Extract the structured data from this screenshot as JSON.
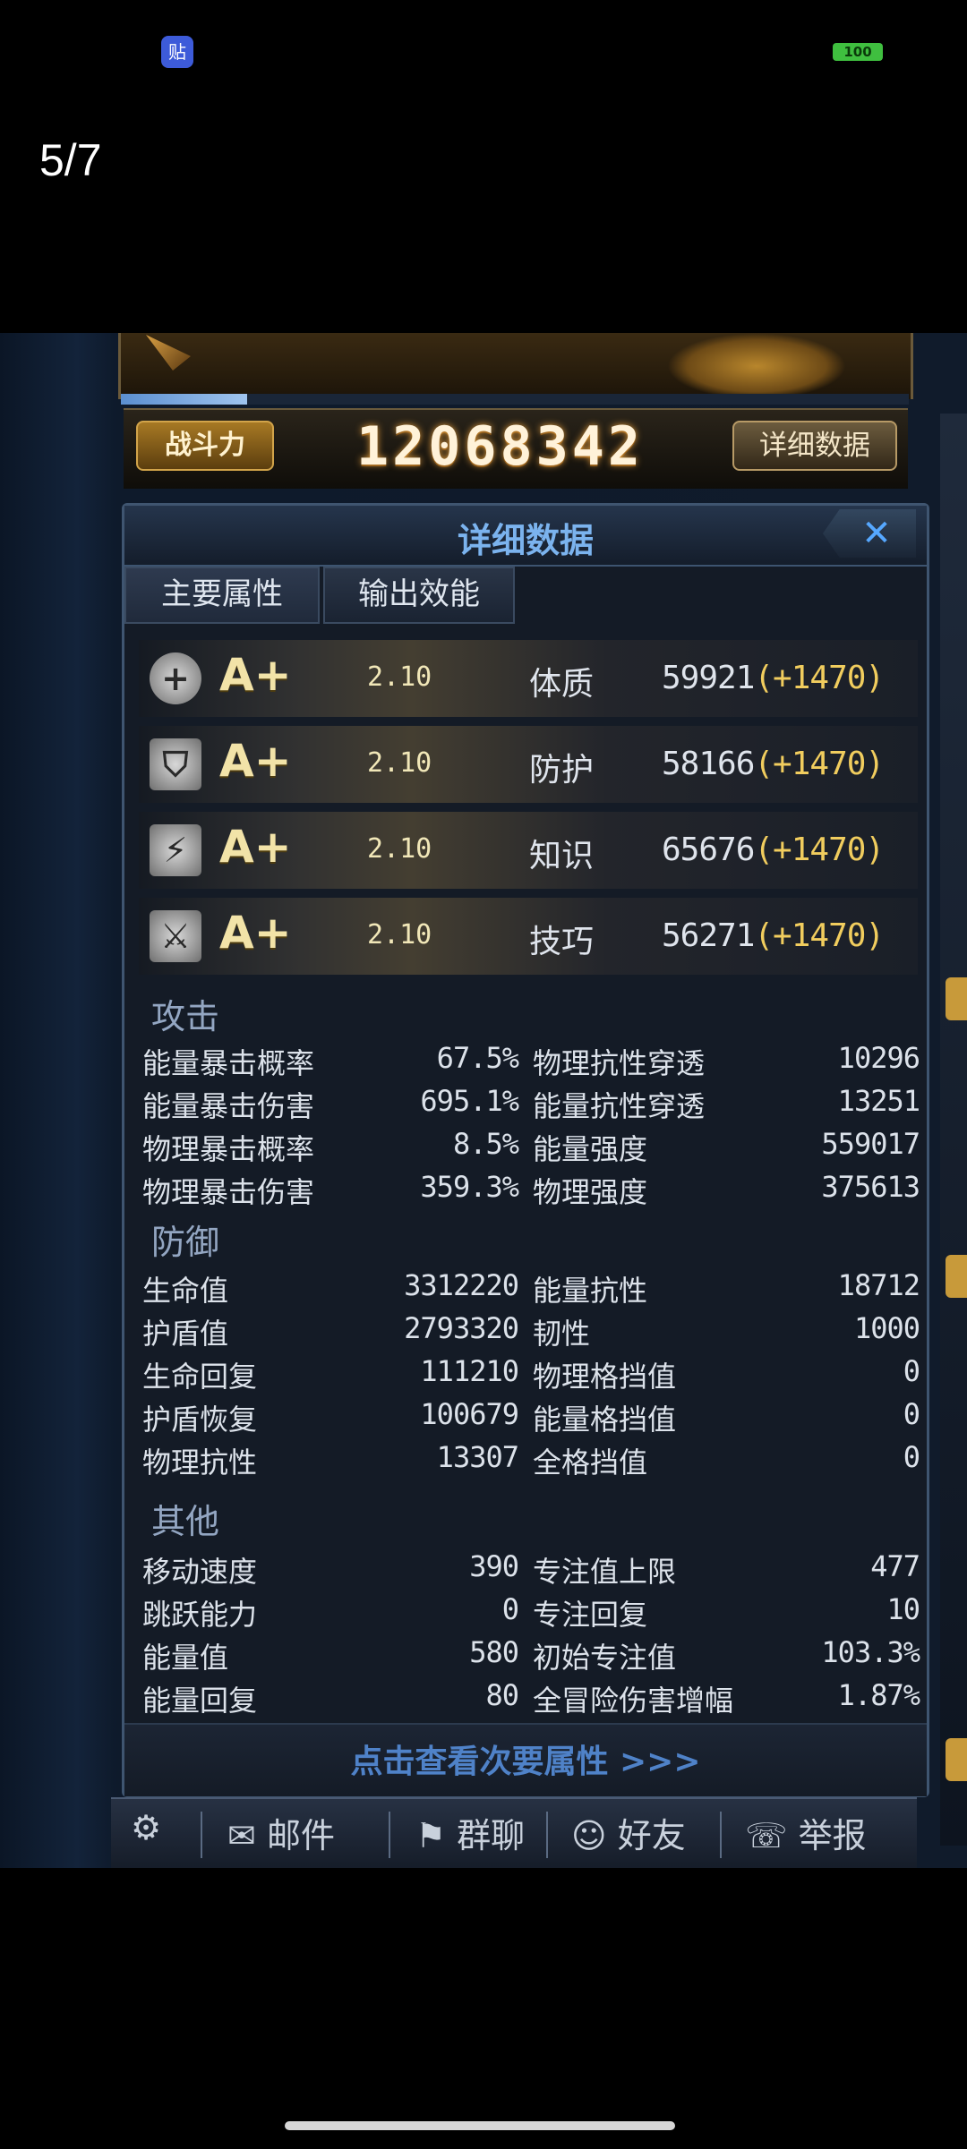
{
  "status_bar": {
    "app_icon_label": "贴",
    "battery_label": "100"
  },
  "viewer": {
    "counter": "5/7"
  },
  "game": {
    "combat_power_label": "战斗力",
    "combat_power_value": "12068342",
    "detail_button_label": "详细数据",
    "xp_fraction": 0.16,
    "panel_title": "详细数据",
    "close_label": "✕",
    "tabs": [
      {
        "label": "主要属性"
      },
      {
        "label": "输出效能"
      }
    ],
    "attributes": [
      {
        "icon": "plus-icon",
        "grade": "A+",
        "multiplier": "2.10",
        "name": "体质",
        "value": "59921",
        "bonus": "(+1470)"
      },
      {
        "icon": "shield-icon",
        "grade": "A+",
        "multiplier": "2.10",
        "name": "防护",
        "value": "58166",
        "bonus": "(+1470)"
      },
      {
        "icon": "knowledge-icon",
        "grade": "A+",
        "multiplier": "2.10",
        "name": "知识",
        "value": "65676",
        "bonus": "(+1470)"
      },
      {
        "icon": "sword-icon",
        "grade": "A+",
        "multiplier": "2.10",
        "name": "技巧",
        "value": "56271",
        "bonus": "(+1470)"
      }
    ],
    "sections": [
      {
        "title": "攻击",
        "rows": [
          {
            "l_label": "能量暴击概率",
            "l_val": "67.5%",
            "r_label": "物理抗性穿透",
            "r_val": "10296"
          },
          {
            "l_label": "能量暴击伤害",
            "l_val": "695.1%",
            "r_label": "能量抗性穿透",
            "r_val": "13251"
          },
          {
            "l_label": "物理暴击概率",
            "l_val": "8.5%",
            "r_label": "能量强度",
            "r_val": "559017"
          },
          {
            "l_label": "物理暴击伤害",
            "l_val": "359.3%",
            "r_label": "物理强度",
            "r_val": "375613"
          }
        ]
      },
      {
        "title": "防御",
        "rows": [
          {
            "l_label": "生命值",
            "l_val": "3312220",
            "r_label": "能量抗性",
            "r_val": "18712"
          },
          {
            "l_label": "护盾值",
            "l_val": "2793320",
            "r_label": "韧性",
            "r_val": "1000"
          },
          {
            "l_label": "生命回复",
            "l_val": "111210",
            "r_label": "物理格挡值",
            "r_val": "0"
          },
          {
            "l_label": "护盾恢复",
            "l_val": "100679",
            "r_label": "能量格挡值",
            "r_val": "0"
          },
          {
            "l_label": "物理抗性",
            "l_val": "13307",
            "r_label": "全格挡值",
            "r_val": "0"
          }
        ]
      },
      {
        "title": "其他",
        "rows": [
          {
            "l_label": "移动速度",
            "l_val": "390",
            "r_label": "专注值上限",
            "r_val": "477"
          },
          {
            "l_label": "跳跃能力",
            "l_val": "0",
            "r_label": "专注回复",
            "r_val": "10"
          },
          {
            "l_label": "能量值",
            "l_val": "580",
            "r_label": "初始专注值",
            "r_val": "103.3%"
          },
          {
            "l_label": "能量回复",
            "l_val": "80",
            "r_label": "全冒险伤害增幅",
            "r_val": "1.87%"
          }
        ]
      }
    ],
    "more_link": "点击查看次要属性 >>>",
    "bottom_menu": [
      {
        "icon": "settings-icon",
        "label": ""
      },
      {
        "icon": "mail-icon",
        "label": "邮件"
      },
      {
        "icon": "flag-icon",
        "label": "群聊"
      },
      {
        "icon": "friends-icon",
        "label": "好友"
      },
      {
        "icon": "report-icon",
        "label": "举报"
      }
    ]
  },
  "colors": {
    "bonus": "#f1cd5e",
    "title_blue": "#7bb3ee",
    "link_blue": "#4f82c8"
  }
}
